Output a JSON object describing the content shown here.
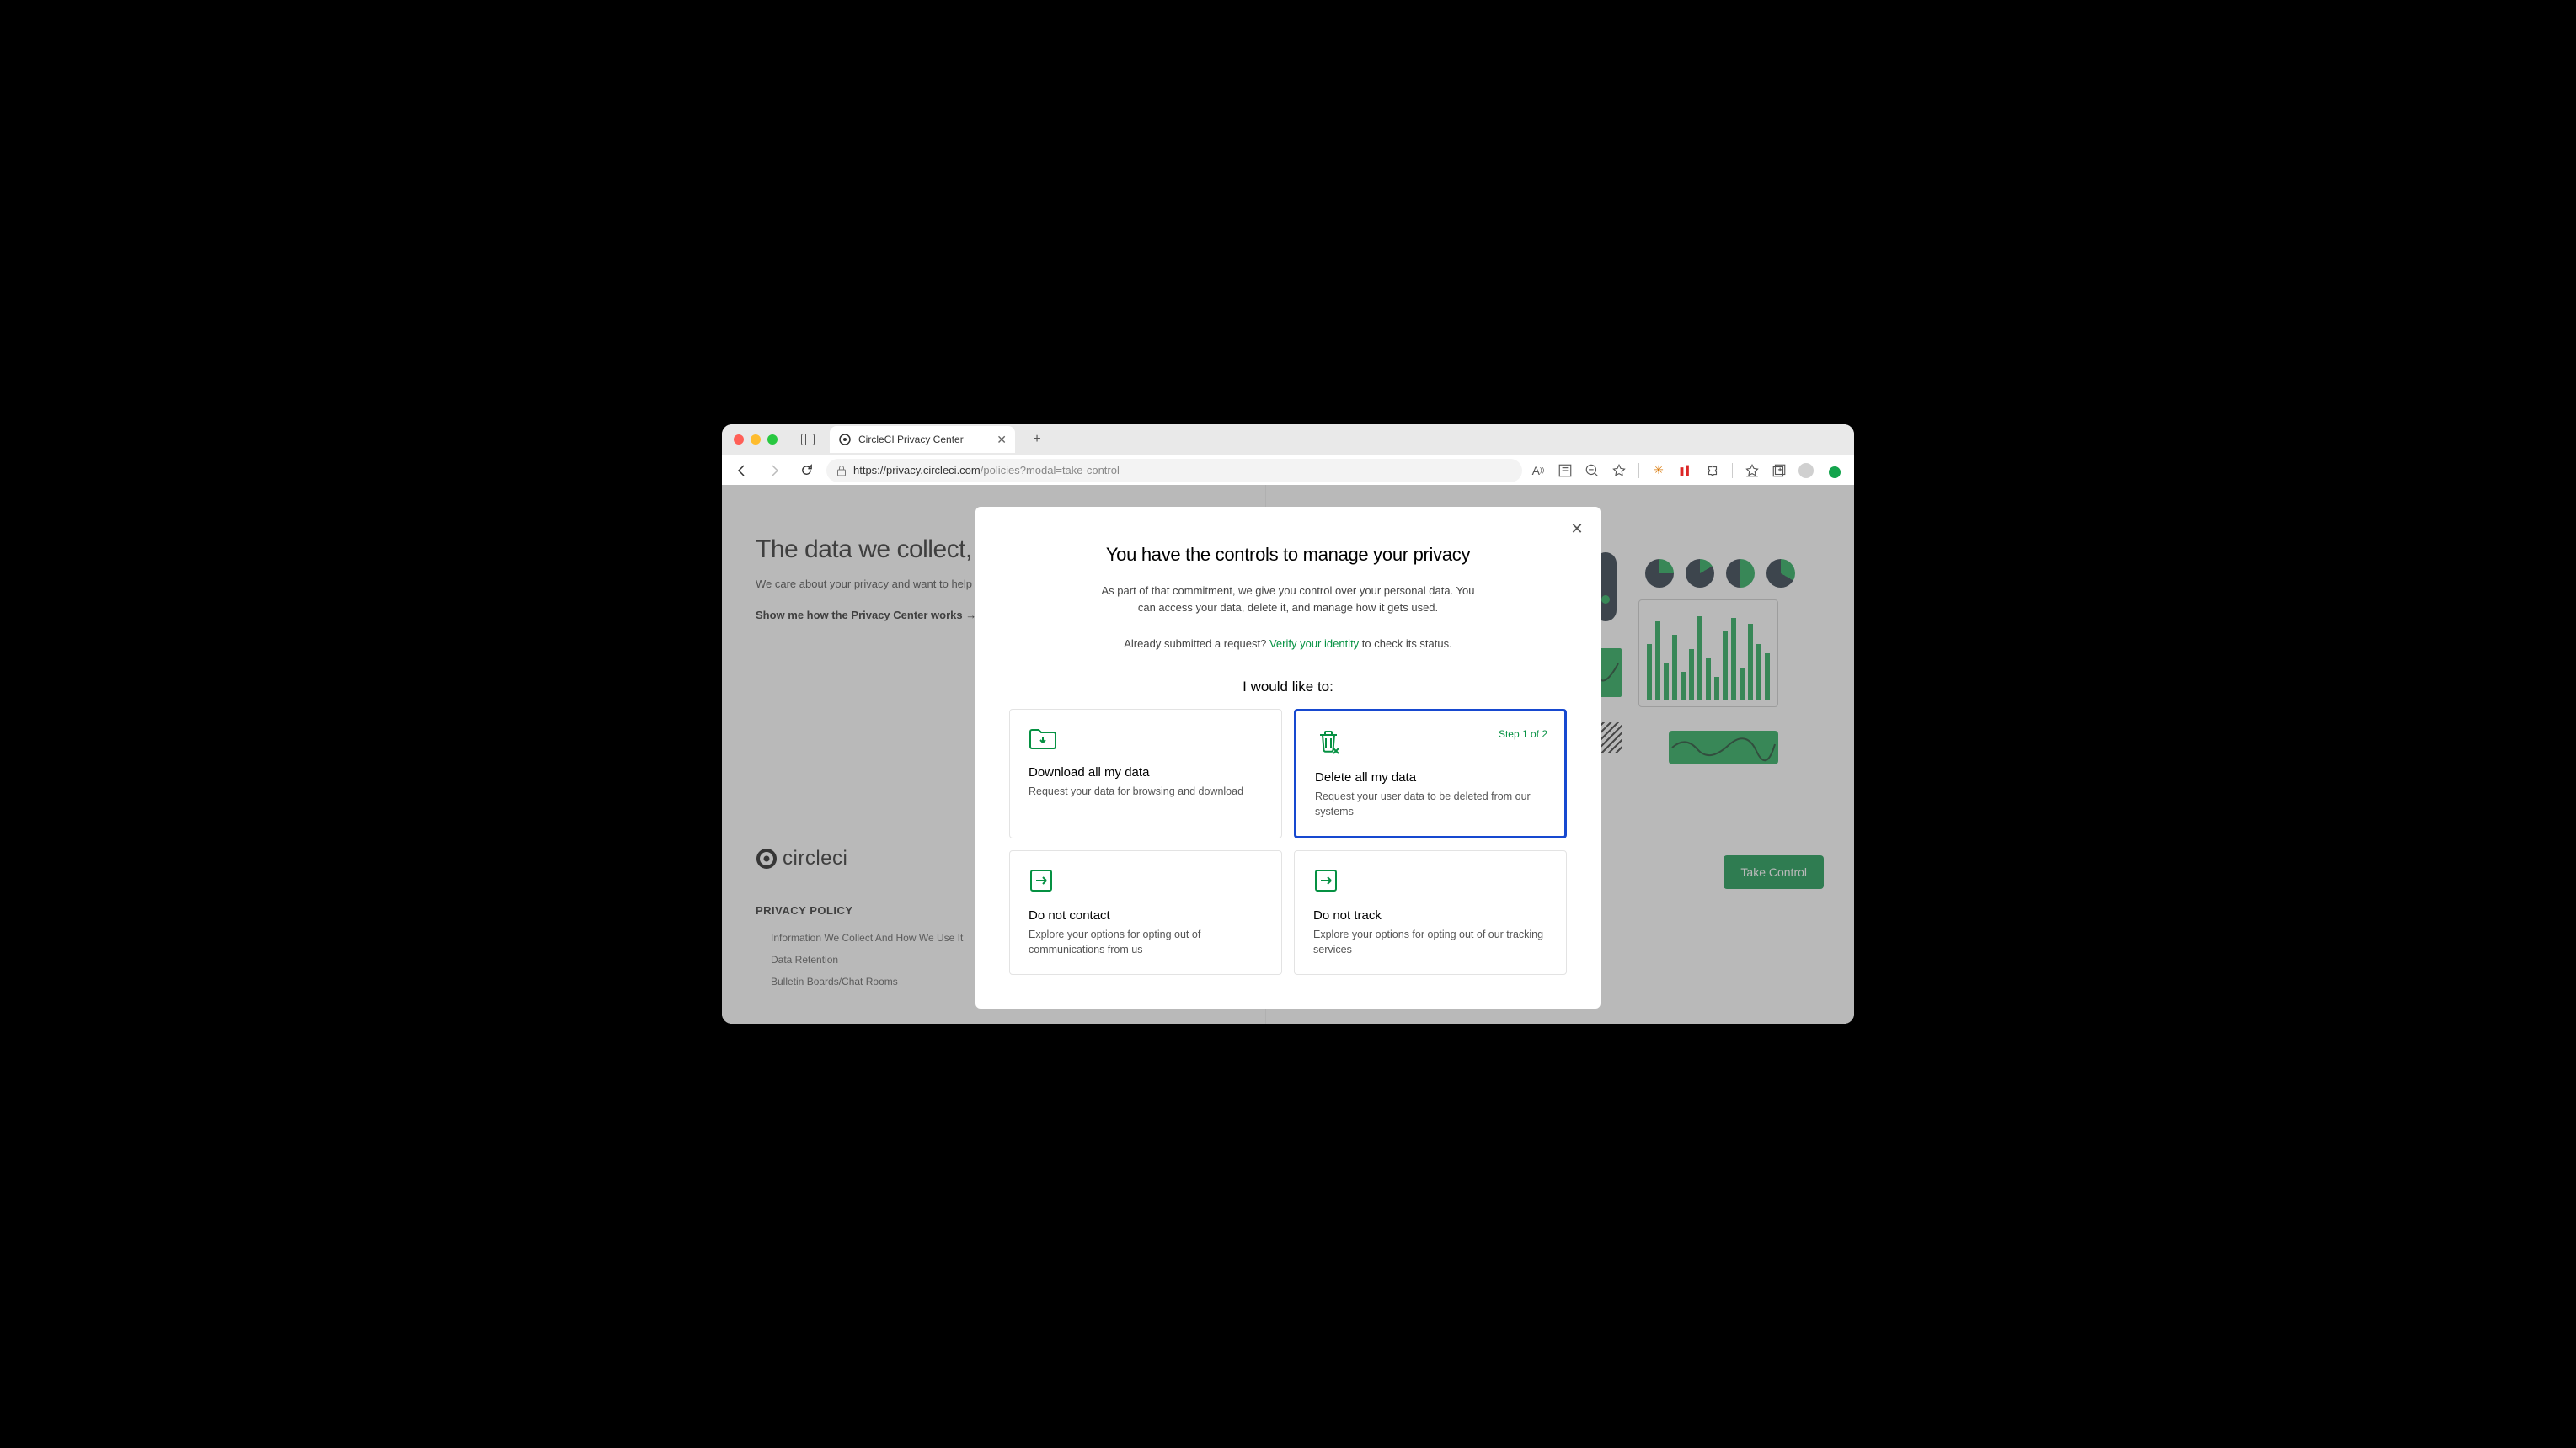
{
  "browser": {
    "tab_title": "CircleCI Privacy Center",
    "url_host": "https://privacy.circleci.com",
    "url_path": "/policies?modal=take-control"
  },
  "page": {
    "heading": "The data we collect, how it's u",
    "sub": "We care about your privacy and want to help you unde",
    "show_me": "Show me how the Privacy Center works →",
    "logo_text": "circleci",
    "policy_heading": "PRIVACY POLICY",
    "policy_links": [
      "Information We Collect And How We Use It",
      "Data Retention",
      "Bulletin Boards/Chat Rooms"
    ],
    "take_control": "Take Control"
  },
  "modal": {
    "title": "You have the controls to manage your privacy",
    "desc": "As part of that commitment, we give you control over your personal data. You can access your data, delete it, and manage how it gets used.",
    "verify_prefix": "Already submitted a request? ",
    "verify_link": "Verify your identity",
    "verify_suffix": " to check its status.",
    "subhead": "I would like to:",
    "step_badge": "Step 1 of 2",
    "cards": [
      {
        "title": "Download all my data",
        "desc": "Request your data for browsing and download"
      },
      {
        "title": "Delete all my data",
        "desc": "Request your user data to be deleted from our systems"
      },
      {
        "title": "Do not contact",
        "desc": "Explore your options for opting out of communications from us"
      },
      {
        "title": "Do not track",
        "desc": "Explore your options for opting out of our tracking services"
      }
    ]
  }
}
